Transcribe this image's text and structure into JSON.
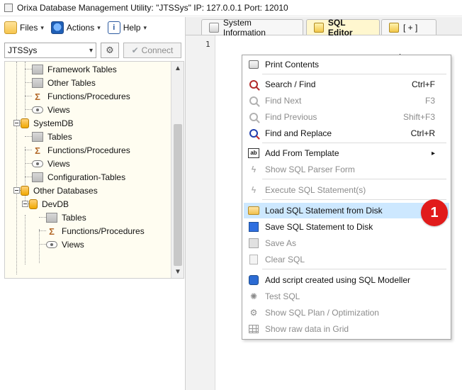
{
  "window": {
    "title": "Orixa Database Management Utility:  \"JTSSys\" IP: 127.0.0.1 Port: 12010"
  },
  "toolbar": {
    "files_label": "Files",
    "actions_label": "Actions",
    "help_label": "Help"
  },
  "connection": {
    "selected_db": "JTSSys",
    "connect_label": "Connect"
  },
  "tree": {
    "rows": [
      {
        "label": "Framework Tables",
        "icon": "table-icon"
      },
      {
        "label": "Other Tables",
        "icon": "table-icon"
      },
      {
        "label": "Functions/Procedures",
        "icon": "sigma-icon"
      },
      {
        "label": "Views",
        "icon": "eye-icon"
      },
      {
        "label": "SystemDB",
        "icon": "database-icon"
      },
      {
        "label": "Tables",
        "icon": "table-icon"
      },
      {
        "label": "Functions/Procedures",
        "icon": "sigma-icon"
      },
      {
        "label": "Views",
        "icon": "eye-icon"
      },
      {
        "label": "Configuration-Tables",
        "icon": "table-icon"
      },
      {
        "label": "Other Databases",
        "icon": "database-icon"
      },
      {
        "label": "DevDB",
        "icon": "database-icon"
      },
      {
        "label": "Tables",
        "icon": "table-icon"
      },
      {
        "label": "Functions/Procedures",
        "icon": "sigma-icon"
      },
      {
        "label": "Views",
        "icon": "eye-icon"
      }
    ]
  },
  "tabs": [
    {
      "label": "System Information"
    },
    {
      "label": "SQL Editor"
    },
    {
      "label": "[ + ]"
    }
  ],
  "editor": {
    "line_number": "1"
  },
  "context_menu": {
    "items": [
      {
        "label": "Print Contents",
        "shortcut": "",
        "disabled": false,
        "icon": "printer-icon"
      },
      {
        "label": "Search / Find",
        "shortcut": "Ctrl+F",
        "disabled": false,
        "icon": "search-icon"
      },
      {
        "label": "Find Next",
        "shortcut": "F3",
        "disabled": true,
        "icon": "find-next-icon"
      },
      {
        "label": "Find Previous",
        "shortcut": "Shift+F3",
        "disabled": true,
        "icon": "find-previous-icon"
      },
      {
        "label": "Find and Replace",
        "shortcut": "Ctrl+R",
        "disabled": false,
        "icon": "find-replace-icon"
      },
      {
        "label": "Add From Template",
        "shortcut": "",
        "disabled": false,
        "icon": "template-icon",
        "submenu": true
      },
      {
        "label": "Show SQL Parser Form",
        "shortcut": "",
        "disabled": true,
        "icon": "parser-icon"
      },
      {
        "label": "Execute SQL Statement(s)",
        "shortcut": "",
        "disabled": true,
        "icon": "execute-icon"
      },
      {
        "label": "Load SQL Statement from Disk",
        "shortcut": "",
        "disabled": false,
        "icon": "open-folder-icon",
        "highlight": true
      },
      {
        "label": "Save SQL Statement to Disk",
        "shortcut": "",
        "disabled": false,
        "icon": "save-icon"
      },
      {
        "label": "Save As",
        "shortcut": "",
        "disabled": true,
        "icon": "save-as-icon"
      },
      {
        "label": "Clear SQL",
        "shortcut": "",
        "disabled": true,
        "icon": "clear-icon"
      },
      {
        "label": "Add script created using SQL Modeller",
        "shortcut": "",
        "disabled": false,
        "icon": "modeller-icon"
      },
      {
        "label": "Test SQL",
        "shortcut": "",
        "disabled": true,
        "icon": "test-icon"
      },
      {
        "label": "Show SQL Plan / Optimization",
        "shortcut": "",
        "disabled": true,
        "icon": "plan-icon"
      },
      {
        "label": "Show raw data in Grid",
        "shortcut": "",
        "disabled": true,
        "icon": "grid-icon"
      }
    ]
  },
  "callout": {
    "number": "1",
    "color": "#e11b1b"
  },
  "colors": {
    "highlight": "#cde8ff",
    "tree_background": "#fffdf1",
    "active_tab": "#fff7cf"
  },
  "icons": {
    "submenu_arrow": "▸",
    "dropdown": "▾",
    "collapse": "−",
    "scroll_up": "▲",
    "scroll_down": "▼",
    "check": "✔",
    "gear": "⚙",
    "help": "i"
  }
}
